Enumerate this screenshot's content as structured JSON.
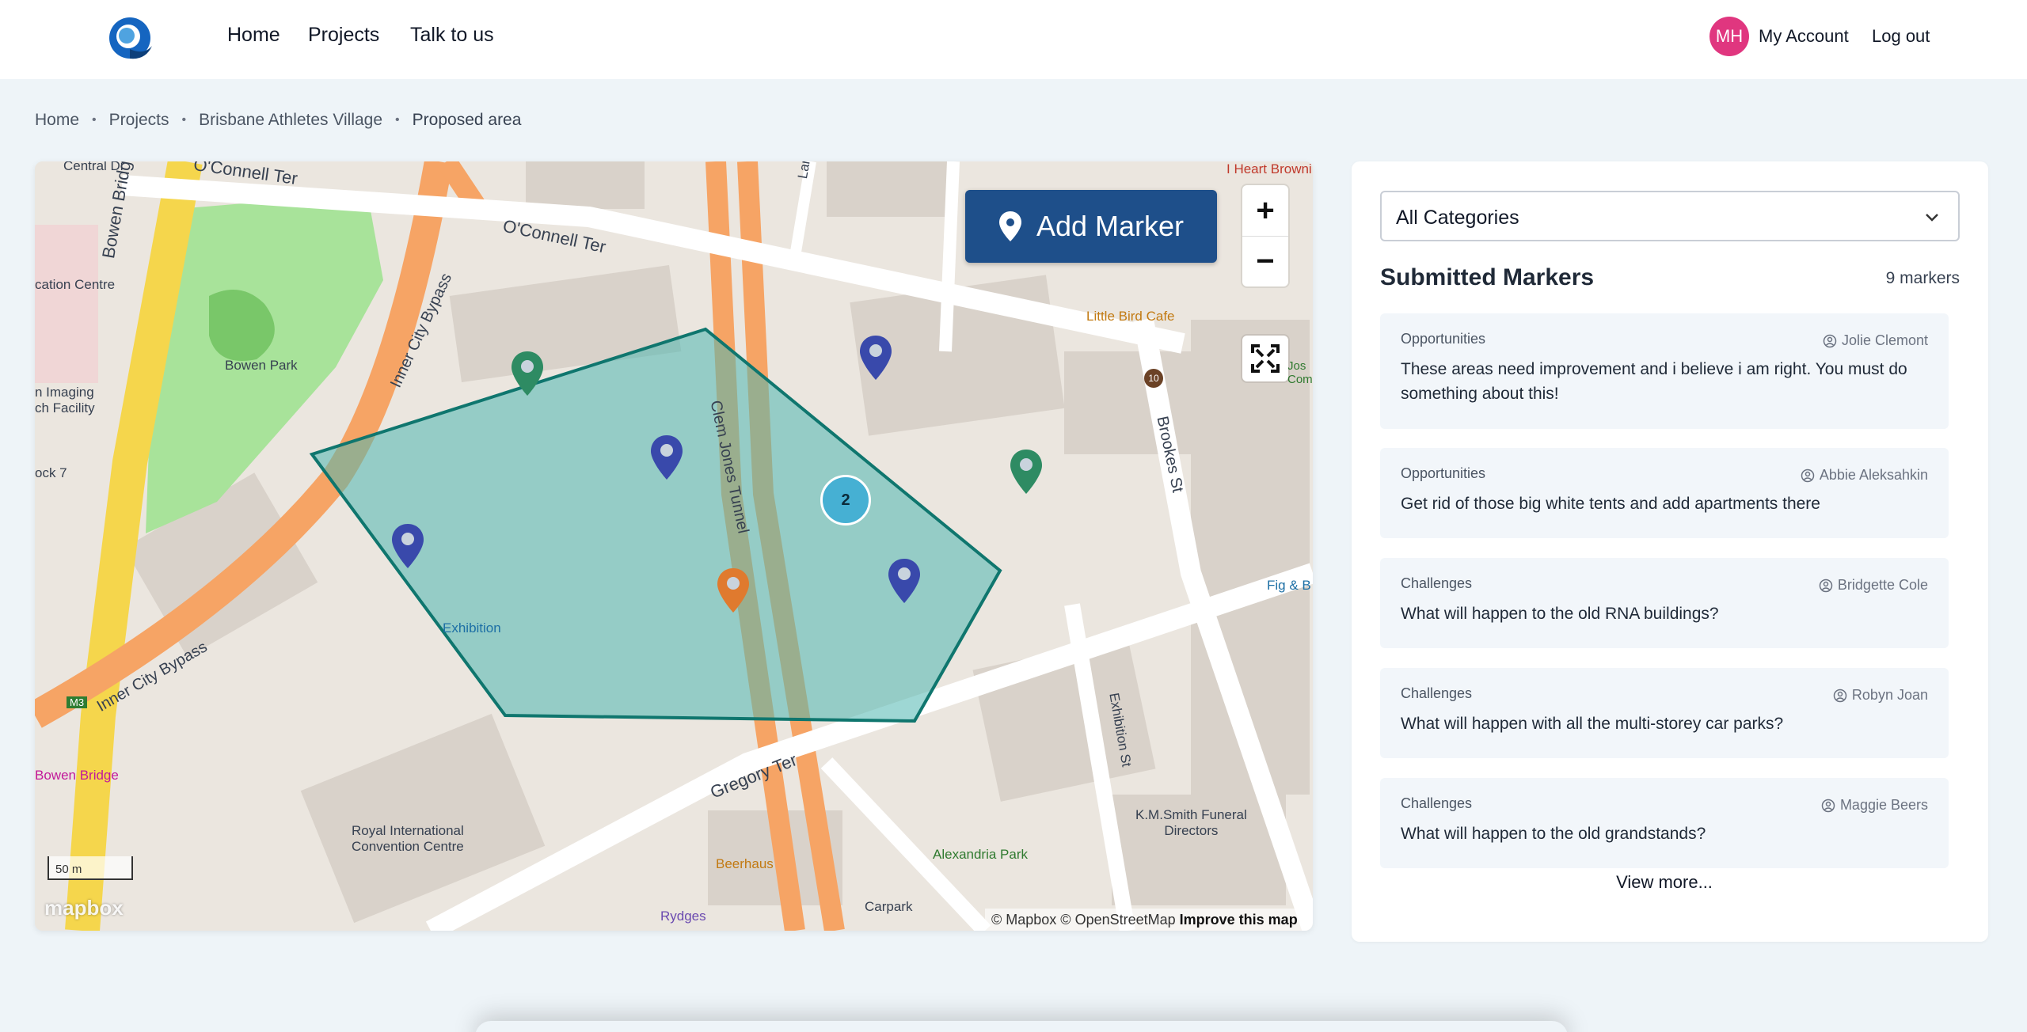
{
  "nav": {
    "links": [
      "Home",
      "Projects",
      "Talk to us"
    ],
    "avatar_initials": "MH",
    "account": "My Account",
    "logout": "Log out"
  },
  "breadcrumb": [
    "Home",
    "Projects",
    "Brisbane Athletes Village",
    "Proposed area"
  ],
  "map": {
    "add_marker_label": "Add Marker",
    "zoom_in": "+",
    "zoom_out": "−",
    "scale_label": "50 m",
    "logo_text": "mapbox",
    "attribution": "© Mapbox © OpenStreetMap",
    "improve_link": "Improve this map",
    "cluster_count": "2",
    "labels": {
      "oconnell_ter_1": "O'Connell Ter",
      "oconnell_ter_2": "O'Connell Ter",
      "bowen_bridge_rd": "Bowen Bridge Rd",
      "bowen_park": "Bowen Park",
      "inner_city_bypass_1": "Inner City Bypass",
      "inner_city_bypass_2": "Inner City Bypass",
      "clem_jones_tunnel": "Clem Jones Tunnel",
      "brookes_st": "Brookes St",
      "exhibition": "Exhibition",
      "exhibition_st": "Exhibition St",
      "gregory_ter": "Gregory Ter",
      "little_bird_cafe": "Little Bird Cafe",
      "i_heart_brownies": "I Heart Browni",
      "royal_international": "Royal International\nConvention Centre",
      "km_smith": "K.M.Smith Funeral\nDirectors",
      "alexandria_park": "Alexandria Park",
      "beerhaus": "Beerhaus",
      "carpark": "Carpark",
      "rydges": "Rydges",
      "bowen_bridge": "Bowen Bridge",
      "central_dr": "Central Dr",
      "education_centre": "cation Centre",
      "imaging_facility": "n Imaging\nch Facility",
      "dock_7": "ock 7",
      "fig_b": "Fig & B",
      "lanh": "Lanha",
      "m3": "M3",
      "jos": "Jos\nComm",
      "badge_10": "10"
    }
  },
  "sidebar": {
    "category_select": "All Categories",
    "title": "Submitted Markers",
    "count": "9 markers",
    "markers": [
      {
        "category": "Opportunities",
        "author": "Jolie Clemont",
        "text": "These areas need improvement and i believe i am right. You must do something about this!"
      },
      {
        "category": "Opportunities",
        "author": "Abbie Aleksahkin",
        "text": "Get rid of those big white tents and add apartments there"
      },
      {
        "category": "Challenges",
        "author": "Bridgette Cole",
        "text": "What will happen to the old RNA buildings?"
      },
      {
        "category": "Challenges",
        "author": "Robyn Joan",
        "text": "What will happen with all the multi-storey car parks?"
      },
      {
        "category": "Challenges",
        "author": "Maggie Beers",
        "text": "What will happen to the old grandstands?"
      }
    ],
    "view_more": "View more..."
  },
  "colors": {
    "primary": "#1e4f8a",
    "avatar": "#e0367f",
    "marker_blue": "#3949ab",
    "marker_green": "#2e8b63",
    "marker_orange": "#e07a2e",
    "polygon_fill": "#4fb7b0",
    "polygon_stroke": "#0f766e",
    "cluster": "#46b0d3"
  }
}
